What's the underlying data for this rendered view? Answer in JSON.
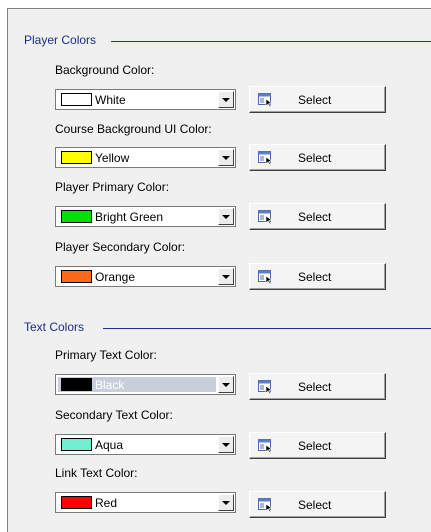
{
  "groups": {
    "player": {
      "title": "Player Colors"
    },
    "text": {
      "title": "Text Colors"
    }
  },
  "fields": [
    {
      "label": "Background Color:",
      "value": "White",
      "swatch": "#ffffff",
      "selected": false
    },
    {
      "label": "Course Background UI Color:",
      "value": "Yellow",
      "swatch": "#ffff00",
      "selected": false
    },
    {
      "label": "Player Primary Color:",
      "value": "Bright Green",
      "swatch": "#00e000",
      "selected": false
    },
    {
      "label": "Player Secondary Color:",
      "value": "Orange",
      "swatch": "#ff6a1a",
      "selected": false
    },
    {
      "label": "Primary Text Color:",
      "value": "Black",
      "swatch": "#000000",
      "selected": true
    },
    {
      "label": "Secondary Text Color:",
      "value": "Aqua",
      "swatch": "#70f0d0",
      "selected": false
    },
    {
      "label": "Link Text Color:",
      "value": "Red",
      "swatch": "#ff0000",
      "selected": false
    }
  ],
  "select_label": "Select",
  "icons": {
    "dropdown": "chevron-down-icon",
    "select": "color-picker-icon"
  },
  "colors": {
    "group_title": "#1c2c8c",
    "group_line": "#20308c",
    "panel_bg": "#f0f0f0"
  }
}
